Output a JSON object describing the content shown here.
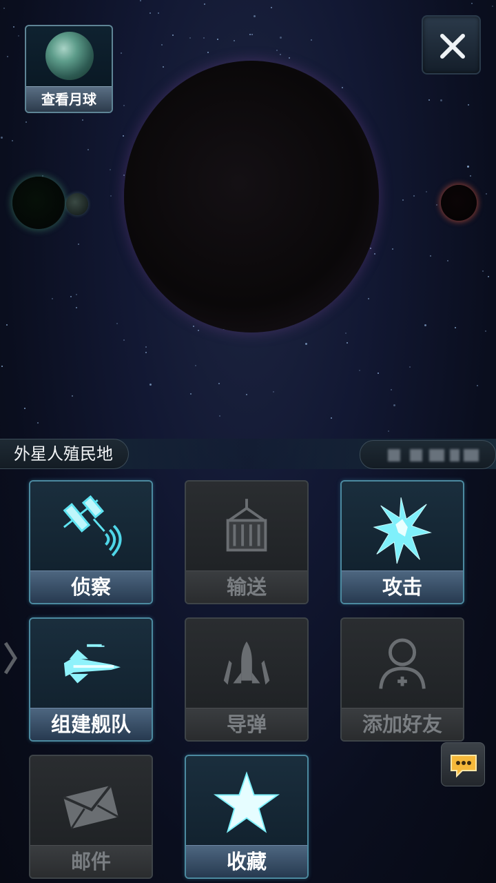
{
  "view_moon": {
    "label": "查看月球",
    "icon": "moon-icon"
  },
  "close": {
    "icon": "close-icon"
  },
  "location": {
    "name": "外星人殖民地",
    "coords": ""
  },
  "actions": [
    {
      "label": "侦察",
      "icon": "satellite-icon",
      "enabled": true
    },
    {
      "label": "输送",
      "icon": "cargo-container-icon",
      "enabled": false
    },
    {
      "label": "攻击",
      "icon": "explosion-icon",
      "enabled": true
    },
    {
      "label": "组建舰队",
      "icon": "fleet-ship-icon",
      "enabled": true
    },
    {
      "label": "导弹",
      "icon": "missile-icon",
      "enabled": false
    },
    {
      "label": "添加好友",
      "icon": "add-friend-icon",
      "enabled": false
    },
    {
      "label": "邮件",
      "icon": "mail-icon",
      "enabled": false
    },
    {
      "label": "收藏",
      "icon": "star-icon",
      "enabled": true
    }
  ],
  "chat": {
    "icon": "chat-icon"
  },
  "side_nav": {
    "icon": "chevron-right-icon"
  },
  "colors": {
    "active_glow": "#4cd6e8",
    "disabled_icon": "#6a6e72",
    "accent_border": "#4c8aa0"
  }
}
